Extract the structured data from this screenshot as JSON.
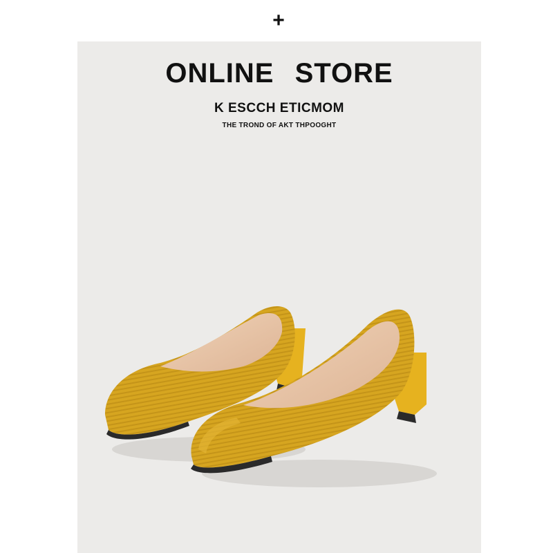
{
  "page": {
    "plus_symbol": "+",
    "headline": "ONLINE STORE",
    "subhead": "K ESCCH ETICMOM",
    "tagline": "THE TROND OF AKT THPOOGHT"
  },
  "product": {
    "image_subject": "pair-of-yellow-knit-block-heel-pumps",
    "colors": {
      "panel_background": "#ecebe9",
      "shoe_knit": "#d6a520",
      "shoe_shadow": "#a87c12",
      "insole": "#e9c7a9",
      "heel": "#e6b21f",
      "sole": "#2a2a2a"
    }
  }
}
